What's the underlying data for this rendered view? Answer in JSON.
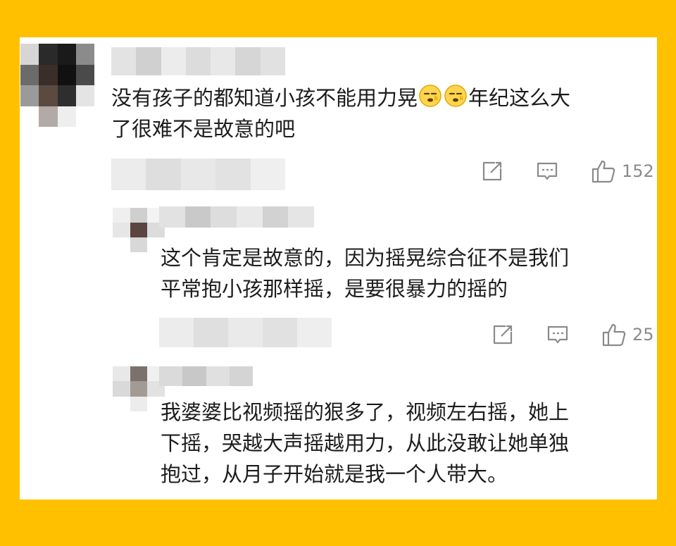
{
  "comments": [
    {
      "text_before": "没有孩子的都知道小孩不能用力晃",
      "emoji": [
        "face-emoji",
        "face-emoji"
      ],
      "text_after": "年纪这么大\n了很难不是故意的吧",
      "likes": "152",
      "icons": {
        "share": "share-icon",
        "reply": "comment-icon",
        "like": "thumbs-up-icon"
      }
    },
    {
      "text": "这个肯定是故意的，因为摇晃综合征不是我们\n平常抱小孩那样摇，是要很暴力的摇的",
      "likes": "25",
      "icons": {
        "share": "share-icon",
        "reply": "comment-icon",
        "like": "thumbs-up-icon"
      }
    },
    {
      "text": "我婆婆比视频摇的狠多了，视频左右摇，她上\n下摇，哭越大声摇越用力，从此没敢让她单独\n抱过，从月子开始就是我一个人带大。"
    }
  ],
  "colors": {
    "background": "#FFC000",
    "card": "#FFFFFF",
    "text": "#1C1C1C",
    "meta": "#8A8A8A"
  }
}
